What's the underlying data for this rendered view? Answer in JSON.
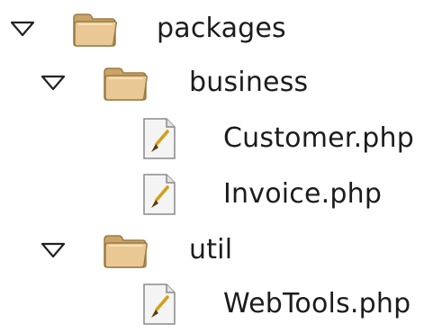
{
  "tree": {
    "nodes": [
      {
        "label": "packages",
        "type": "folder",
        "expanded": true,
        "icon": "folder-icon",
        "toggle_icon": "triangle-down-icon"
      },
      {
        "label": "business",
        "type": "folder",
        "expanded": true,
        "icon": "folder-icon",
        "toggle_icon": "triangle-down-icon"
      },
      {
        "label": "Customer.php",
        "type": "file",
        "icon": "php-file-icon"
      },
      {
        "label": "Invoice.php",
        "type": "file",
        "icon": "php-file-icon"
      },
      {
        "label": "util",
        "type": "folder",
        "expanded": true,
        "icon": "folder-icon",
        "toggle_icon": "triangle-down-icon"
      },
      {
        "label": "WebTools.php",
        "type": "file",
        "icon": "php-file-icon"
      }
    ]
  },
  "colors": {
    "folder_fill": "#e9c894",
    "folder_shade": "#c9a466",
    "folder_outline": "#9a7a45",
    "file_page": "#f4f4f4",
    "file_outline": "#8a8a8a",
    "brush_handle": "#d4a017",
    "brush_tip": "#5a3a10",
    "toggle_outline": "#222222"
  }
}
